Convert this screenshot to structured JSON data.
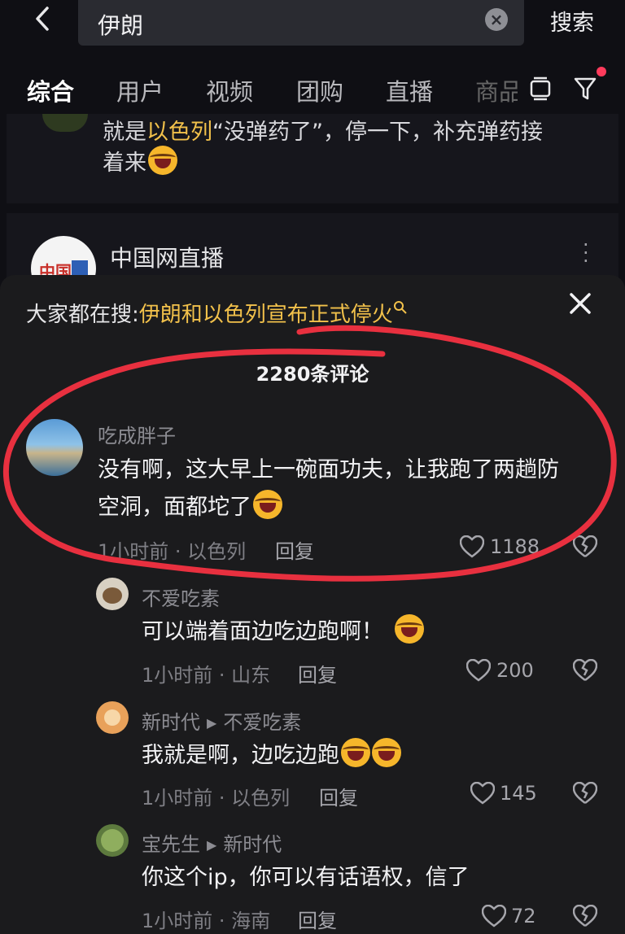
{
  "search": {
    "query": "伊朗",
    "button_label": "搜索"
  },
  "tabs": [
    {
      "label": "综合"
    },
    {
      "label": "用户"
    },
    {
      "label": "视频"
    },
    {
      "label": "团购"
    },
    {
      "label": "直播"
    },
    {
      "label": "商品"
    }
  ],
  "feed": {
    "post_text_line1_prefix": "就是",
    "post_text_line1_highlight": "以色列",
    "post_text_line1_rest": "“没弹药了”，停一下，补充弹药接",
    "post_text_line2": "着来",
    "account_name": "中国网直播"
  },
  "sheet": {
    "hot_prefix": "大家都在搜:",
    "hot_query": "伊朗和以色列宣布正式停火",
    "comment_count": "2280条评论"
  },
  "comments": [
    {
      "user": "吃成胖子",
      "text_line1": "没有啊，这大早上一碗面功夫，让我跑了两趟防",
      "text_line2": "空洞，面都坨了",
      "meta": "1小时前 · 以色列",
      "reply": "回复",
      "likes": "1188"
    },
    {
      "user": "不爱吃素",
      "text": "可以端着面边吃边跑啊！",
      "meta": "1小时前 · 山东",
      "reply": "回复",
      "likes": "200"
    },
    {
      "user": "新时代",
      "reply_to": "不爱吃素",
      "text": "我就是啊，边吃边跑",
      "meta": "1小时前 · 以色列",
      "reply": "回复",
      "likes": "145"
    },
    {
      "user": "宝先生",
      "reply_to": "新时代",
      "text": "你这个ip，你可以有话语权，信了",
      "meta": "1小时前 · 海南",
      "reply": "回复",
      "likes": "72"
    }
  ],
  "colors": {
    "highlight": "#f2c14b",
    "annotation_circle": "#e8303f",
    "notification_dot": "#ff3b5c"
  }
}
